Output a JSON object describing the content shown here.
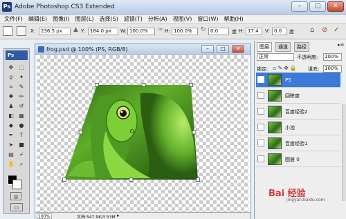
{
  "window": {
    "title": "Adobe Photoshop CS3 Extended",
    "app_icon": "Ps"
  },
  "menu": [
    "文件(F)",
    "编辑(E)",
    "图像(I)",
    "图层(L)",
    "选择(S)",
    "滤镜(T)",
    "分析(A)",
    "视图(V)",
    "窗口(W)",
    "帮助(H)"
  ],
  "options": {
    "x_label": "X:",
    "x_value": "236.5 px",
    "y_label": "Y:",
    "y_value": "184.0 px",
    "w_label": "W:",
    "w_value": "100.0%",
    "h_label": "H:",
    "h_value": "100.0%",
    "angle_value": "0.0",
    "h_skew_label": "度",
    "h_skew_value": "17.4",
    "v_label": "V:",
    "v_value": "0.0",
    "v_unit": "度"
  },
  "toolbox": {
    "badge": "Ps"
  },
  "document": {
    "title": "frog.psd @ 100% (PS, RGB/8)",
    "zoom": "100%",
    "doc_info": "文档:547.9K/3.53M"
  },
  "layers_panel": {
    "tabs": [
      "图层",
      "通道",
      "路径"
    ],
    "blend_mode": "正常",
    "opacity_label": "不透明度:",
    "opacity_value": "100%",
    "lock_label": "锁定:",
    "fill_label": "填充:",
    "fill_value": "100%",
    "layers": [
      {
        "name": "PS",
        "selected": true
      },
      {
        "name": "回眸度",
        "selected": false
      },
      {
        "name": "百度经验2",
        "selected": false
      },
      {
        "name": "小池",
        "selected": false
      },
      {
        "name": "百度经验1",
        "selected": false
      },
      {
        "name": "图层 0",
        "selected": false
      }
    ]
  },
  "watermark": {
    "text": "Bai 经验",
    "sub": "jingyan.baidu.com"
  }
}
